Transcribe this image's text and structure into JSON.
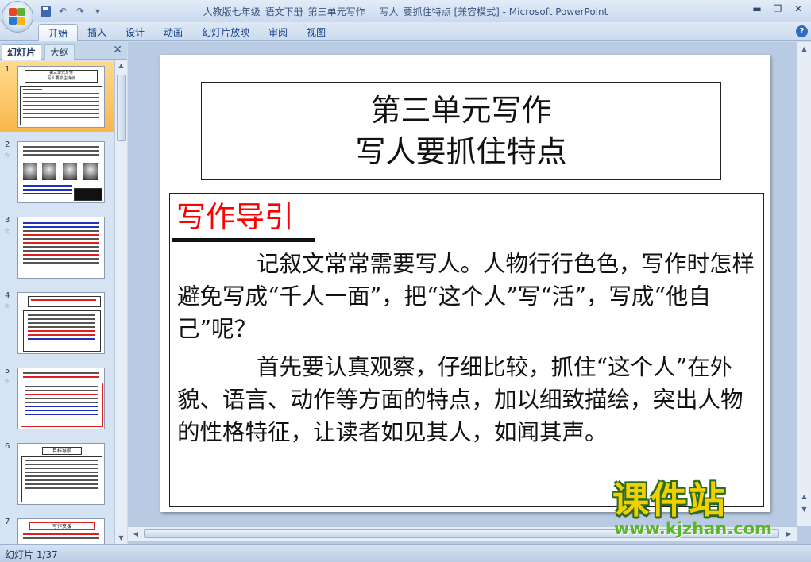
{
  "window": {
    "title": "人教版七年级_语文下册_第三单元写作___写人_要抓住特点 [兼容模式] - Microsoft PowerPoint",
    "minimize": "▬",
    "restore": "❐",
    "close": "✕"
  },
  "quick_access": {
    "undo": "↶",
    "redo": "↷",
    "more": "▾"
  },
  "ribbon": {
    "tabs": [
      "开始",
      "插入",
      "设计",
      "动画",
      "幻灯片放映",
      "审阅",
      "视图"
    ],
    "help": "?"
  },
  "left_panel": {
    "tabs": [
      "幻灯片",
      "大纲"
    ],
    "close": "✕",
    "thumbnails": [
      {
        "number": "1",
        "title_1": "第三单元写作",
        "title_2": "写人要抓住特点",
        "selected": true
      },
      {
        "number": "2",
        "has_animation": true
      },
      {
        "number": "3",
        "has_animation": true
      },
      {
        "number": "4",
        "has_animation": true
      },
      {
        "number": "5",
        "has_animation": true
      },
      {
        "number": "6",
        "title": "目标导航"
      },
      {
        "number": "7",
        "title": "写作支援"
      }
    ],
    "animation_marker": "☆"
  },
  "slide": {
    "title_line_1": "第三单元写作",
    "title_line_2": "写人要抓住特点",
    "guide_heading": "写作导引",
    "paragraph_1": "记叙文常常需要写人。人物行行色色，写作时怎样避免写成“千人一面”，把“这个人”写“活”，写成“他自己”呢？",
    "paragraph_2": "首先要认真观察，仔细比较，抓住“这个人”在外貌、语言、动作等方面的特点，加以细致描绘，突出人物的性格特征，让读者如见其人，如闻其声。"
  },
  "watermark": {
    "logo": "课件站",
    "url": "www.kjzhan.com"
  },
  "status_bar": {
    "slide_indicator": "幻灯片 1/37"
  },
  "scroll": {
    "up": "▲",
    "down": "▼",
    "left": "◀",
    "right": "▶"
  }
}
